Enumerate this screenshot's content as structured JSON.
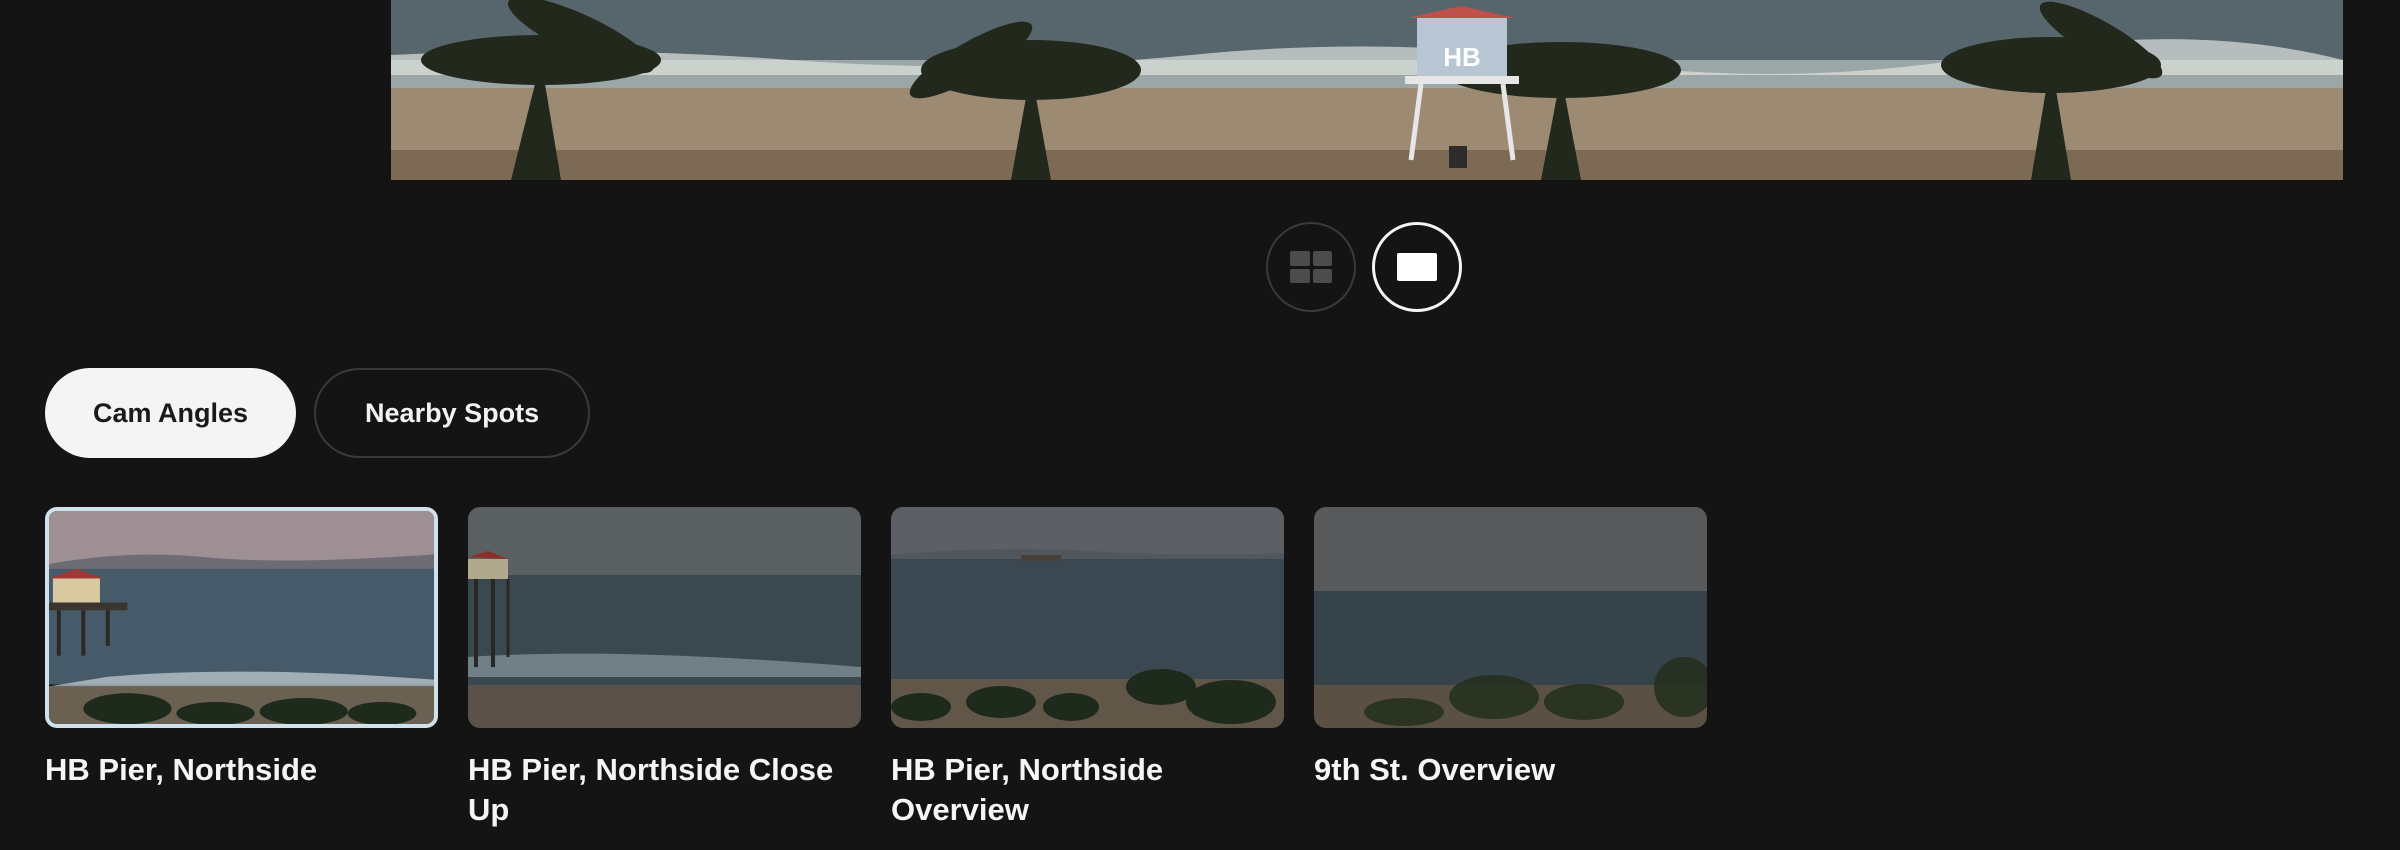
{
  "view_toggle": {
    "grid_icon": "grid-view-icon",
    "single_icon": "single-view-icon",
    "selected": "single"
  },
  "tabs": [
    {
      "label": "Cam Angles",
      "active": true
    },
    {
      "label": "Nearby Spots",
      "active": false
    }
  ],
  "cams": [
    {
      "title": "HB Pier, Northside",
      "selected": true
    },
    {
      "title": "HB Pier, Northside Close Up",
      "selected": false
    },
    {
      "title": "HB Pier, Northside Overview",
      "selected": false
    },
    {
      "title": "9th St. Overview",
      "selected": false
    }
  ],
  "hero": {
    "tower_sign": "HB"
  }
}
